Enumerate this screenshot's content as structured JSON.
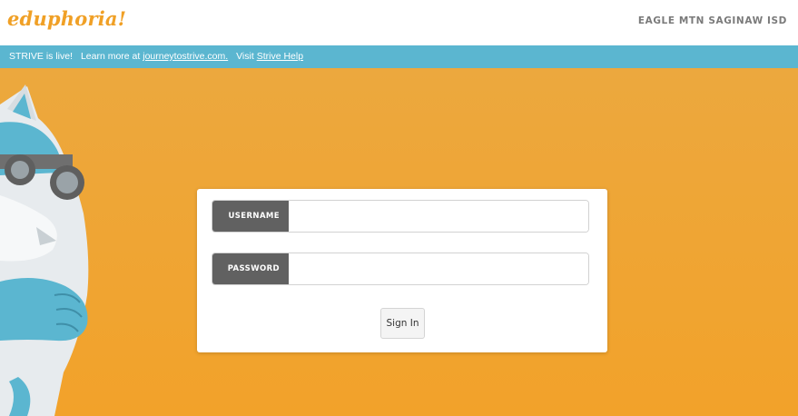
{
  "header": {
    "logo_text": "eduphoria!",
    "district": "EAGLE MTN SAGINAW ISD"
  },
  "banner": {
    "text1": "STRIVE is live!",
    "text2": "Learn more at",
    "link1": "journeytostrive.com.",
    "text3": "Visit",
    "link2": "Strive Help"
  },
  "login": {
    "username_label": "USERNAME",
    "username_value": "",
    "password_label": "PASSWORD",
    "password_value": "",
    "signin_label": "Sign In"
  },
  "colors": {
    "brand_orange": "#f0a026",
    "banner_blue": "#5bb6d0",
    "label_gray": "#616161"
  },
  "icons": {
    "mascot": "goggled-cat-mascot"
  }
}
